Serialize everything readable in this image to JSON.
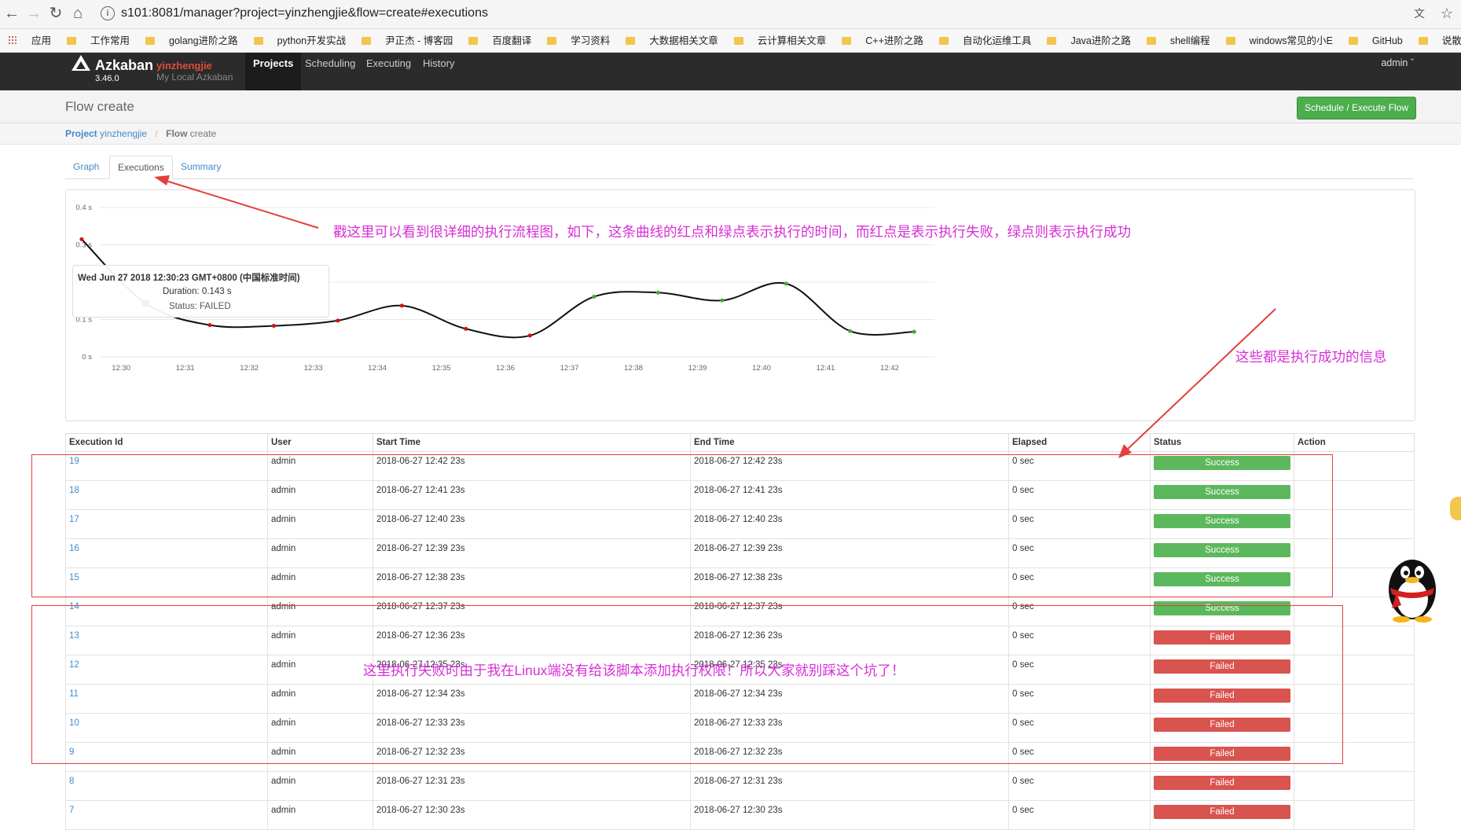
{
  "browser": {
    "url": "s101:8081/manager?project=yinzhengjie&flow=create#executions",
    "bookmarks": [
      "应用",
      "工作常用",
      "golang进阶之路",
      "python开发实战",
      "尹正杰 - 博客园",
      "百度翻译",
      "学习资料",
      "大数据相关文章",
      "云计算相关文章",
      "C++进阶之路",
      "自动化运维工具",
      "Java进阶之路",
      "shell编程",
      "windows常见的小E",
      "GitHub",
      "说散就散_搜索 QQ音"
    ]
  },
  "app": {
    "brand": "Azkaban",
    "project": "yinzhengjie",
    "version": "3.46.0",
    "subtitle": "My Local Azkaban",
    "nav": [
      "Projects",
      "Scheduling",
      "Executing",
      "History"
    ],
    "user": "admin ˇ"
  },
  "header": {
    "title": "Flow create",
    "execute_button": "Schedule / Execute Flow"
  },
  "breadcrumb": {
    "project_label": "Project",
    "project_name": "yinzhengjie",
    "current_label": "Flow",
    "current_name": "create"
  },
  "tabs": [
    "Graph",
    "Executions",
    "Summary"
  ],
  "tooltip": {
    "time": "Wed Jun 27 2018 12:30:23 GMT+0800 (中国标准时间)",
    "duration": "Duration: 0.143 s",
    "status": "Status: FAILED"
  },
  "chart_data": {
    "type": "line",
    "x_ticks": [
      "12:30",
      "12:31",
      "12:32",
      "12:33",
      "12:34",
      "12:35",
      "12:36",
      "12:37",
      "12:38",
      "12:39",
      "12:40",
      "12:41",
      "12:42"
    ],
    "y_ticks": [
      "0 s",
      "0.1 s",
      "0.2 s",
      "0.3 s",
      "0.4 s"
    ],
    "ylim": [
      0,
      0.4
    ],
    "x": [
      "12:29:23",
      "12:30:23",
      "12:31:23",
      "12:32:23",
      "12:33:23",
      "12:34:23",
      "12:35:23",
      "12:36:23",
      "12:37:23",
      "12:38:23",
      "12:39:23",
      "12:40:23",
      "12:41:23",
      "12:42:23"
    ],
    "values": [
      0.315,
      0.143,
      0.085,
      0.083,
      0.097,
      0.137,
      0.075,
      0.057,
      0.161,
      0.172,
      0.151,
      0.196,
      0.069,
      0.067
    ],
    "status": [
      "FAILED",
      "FAILED",
      "FAILED",
      "FAILED",
      "FAILED",
      "FAILED",
      "FAILED",
      "FAILED",
      "SUCCEEDED",
      "SUCCEEDED",
      "SUCCEEDED",
      "SUCCEEDED",
      "SUCCEEDED",
      "SUCCEEDED"
    ],
    "grid": true,
    "colors": {
      "failed": "#cc1111",
      "success": "#44aa33",
      "line": "#111111"
    }
  },
  "table": {
    "headers": [
      "Execution Id",
      "User",
      "Start Time",
      "End Time",
      "Elapsed",
      "Status",
      "Action"
    ],
    "rows": [
      {
        "id": "19",
        "user": "admin",
        "start": "2018-06-27 12:42 23s",
        "end": "2018-06-27 12:42 23s",
        "elapsed": "0 sec",
        "status": "Success"
      },
      {
        "id": "18",
        "user": "admin",
        "start": "2018-06-27 12:41 23s",
        "end": "2018-06-27 12:41 23s",
        "elapsed": "0 sec",
        "status": "Success"
      },
      {
        "id": "17",
        "user": "admin",
        "start": "2018-06-27 12:40 23s",
        "end": "2018-06-27 12:40 23s",
        "elapsed": "0 sec",
        "status": "Success"
      },
      {
        "id": "16",
        "user": "admin",
        "start": "2018-06-27 12:39 23s",
        "end": "2018-06-27 12:39 23s",
        "elapsed": "0 sec",
        "status": "Success"
      },
      {
        "id": "15",
        "user": "admin",
        "start": "2018-06-27 12:38 23s",
        "end": "2018-06-27 12:38 23s",
        "elapsed": "0 sec",
        "status": "Success"
      },
      {
        "id": "14",
        "user": "admin",
        "start": "2018-06-27 12:37 23s",
        "end": "2018-06-27 12:37 23s",
        "elapsed": "0 sec",
        "status": "Success"
      },
      {
        "id": "13",
        "user": "admin",
        "start": "2018-06-27 12:36 23s",
        "end": "2018-06-27 12:36 23s",
        "elapsed": "0 sec",
        "status": "Failed"
      },
      {
        "id": "12",
        "user": "admin",
        "start": "2018-06-27 12:35 23s",
        "end": "2018-06-27 12:35 23s",
        "elapsed": "0 sec",
        "status": "Failed"
      },
      {
        "id": "11",
        "user": "admin",
        "start": "2018-06-27 12:34 23s",
        "end": "2018-06-27 12:34 23s",
        "elapsed": "0 sec",
        "status": "Failed"
      },
      {
        "id": "10",
        "user": "admin",
        "start": "2018-06-27 12:33 23s",
        "end": "2018-06-27 12:33 23s",
        "elapsed": "0 sec",
        "status": "Failed"
      },
      {
        "id": "9",
        "user": "admin",
        "start": "2018-06-27 12:32 23s",
        "end": "2018-06-27 12:32 23s",
        "elapsed": "0 sec",
        "status": "Failed"
      },
      {
        "id": "8",
        "user": "admin",
        "start": "2018-06-27 12:31 23s",
        "end": "2018-06-27 12:31 23s",
        "elapsed": "0 sec",
        "status": "Failed"
      },
      {
        "id": "7",
        "user": "admin",
        "start": "2018-06-27 12:30 23s",
        "end": "2018-06-27 12:30 23s",
        "elapsed": "0 sec",
        "status": "Failed"
      }
    ]
  },
  "annotations": {
    "chart_note": "戳这里可以看到很详细的执行流程图，如下，这条曲线的红点和绿点表示执行的时间，而红点是表示执行失败，绿点则表示执行成功",
    "success_note": "这些都是执行成功的信息",
    "failed_note": "这里执行失败时由于我在Linux端没有给该脚本添加执行权限！所以大家就别踩这个坑了！"
  }
}
